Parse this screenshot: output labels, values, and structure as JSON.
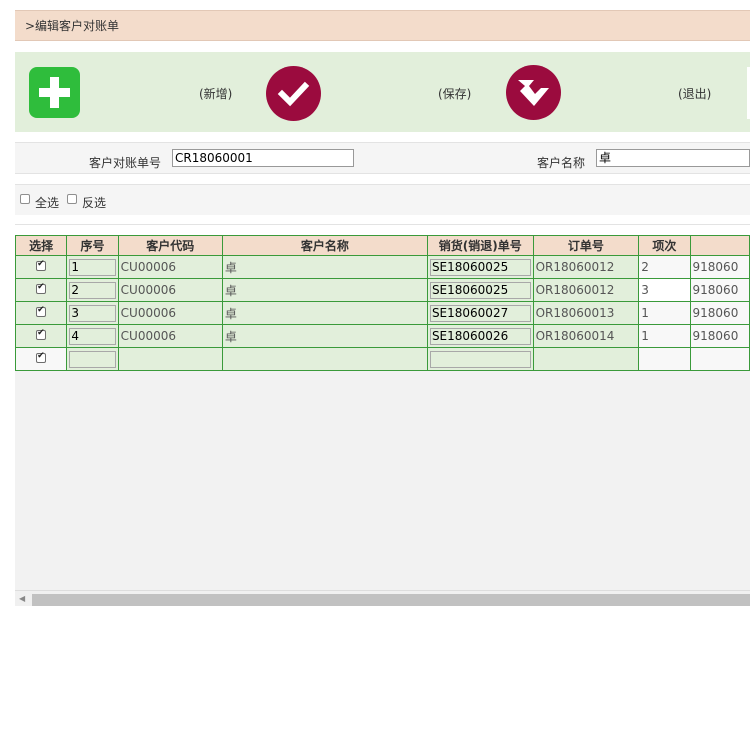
{
  "page_title": ">编辑客户对账单",
  "toolbar": {
    "add_label": "(新增)",
    "save_label": "(保存)",
    "exit_label": "(退出)"
  },
  "form": {
    "statement_no_label": "客户对账单号",
    "statement_no_value": "CR18060001",
    "customer_name_label": "客户名称",
    "customer_name_value": "卓"
  },
  "selection": {
    "select_all_label": "全选",
    "invert_label": "反选"
  },
  "table": {
    "headers": [
      "选择",
      "序号",
      "客户代码",
      "客户名称",
      "销货(销退)单号",
      "订单号",
      "项次",
      ""
    ],
    "rows": [
      {
        "checked": true,
        "seq": "1",
        "customer_code": "CU00006",
        "customer_name": "卓",
        "sales_no": "SE18060025",
        "order_no": "OR18060012",
        "item": "2",
        "extra": "918060"
      },
      {
        "checked": true,
        "seq": "2",
        "customer_code": "CU00006",
        "customer_name": "卓",
        "sales_no": "SE18060025",
        "order_no": "OR18060012",
        "item": "3",
        "extra": "918060"
      },
      {
        "checked": true,
        "seq": "3",
        "customer_code": "CU00006",
        "customer_name": "卓",
        "sales_no": "SE18060027",
        "order_no": "OR18060013",
        "item": "1",
        "extra": "918060"
      },
      {
        "checked": true,
        "seq": "4",
        "customer_code": "CU00006",
        "customer_name": "卓",
        "sales_no": "SE18060026",
        "order_no": "OR18060014",
        "item": "1",
        "extra": "918060"
      },
      {
        "checked": true,
        "seq": "",
        "customer_code": "",
        "customer_name": "",
        "sales_no": "",
        "order_no": "",
        "item": "",
        "extra": ""
      }
    ]
  },
  "colors": {
    "title_bg": "#f3dccb",
    "toolbar_bg": "#e2efdb",
    "add_button": "#2fbd3c",
    "action_button": "#9b0b3e",
    "grid_border": "#3a9a3a"
  },
  "icons": {
    "add": "plus-icon",
    "save": "check-icon",
    "exit": "return-arrow-icon"
  }
}
